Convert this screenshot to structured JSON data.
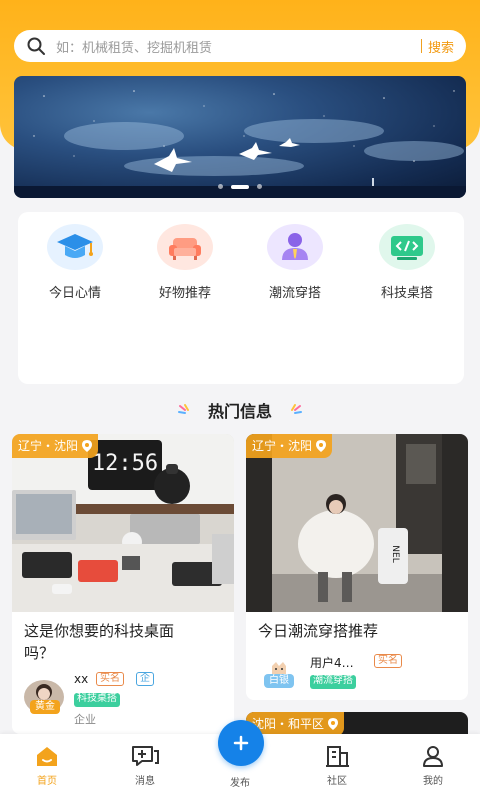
{
  "search": {
    "placeholder": "如：机械租赁、挖掘机租赁",
    "button": "搜索"
  },
  "categories": [
    {
      "label": "今日心情",
      "icon": "graduation-cap-icon"
    },
    {
      "label": "好物推荐",
      "icon": "sofa-icon"
    },
    {
      "label": "潮流穿搭",
      "icon": "person-icon"
    },
    {
      "label": "科技桌搭",
      "icon": "code-icon"
    }
  ],
  "section": {
    "title": "热门信息"
  },
  "cards": [
    {
      "location": "辽宁・沈阳",
      "title_line1": "这是你想要的科技桌面",
      "title_line2": "吗？",
      "user": "xx",
      "level": "黄金",
      "tags": [
        "实名",
        "企"
      ],
      "category": "科技桌搭",
      "company": "企业"
    },
    {
      "location": "辽宁・沈阳",
      "title_line1": "今日潮流穿搭推荐",
      "user": "用户4…",
      "level": "白银",
      "tags": [
        "实名"
      ],
      "category": "潮流穿搭"
    },
    {
      "location": "沈阳・和平区"
    }
  ],
  "tabbar": [
    {
      "label": "首页",
      "icon": "home-icon",
      "active": true
    },
    {
      "label": "消息",
      "icon": "message-icon"
    },
    {
      "label": "发布",
      "icon": "plus-icon"
    },
    {
      "label": "社区",
      "icon": "building-icon"
    },
    {
      "label": "我的",
      "icon": "user-icon"
    }
  ],
  "colors": {
    "accent": "#f3a31c",
    "primary": "#1582e8",
    "tag_green": "#3ccf9e"
  }
}
